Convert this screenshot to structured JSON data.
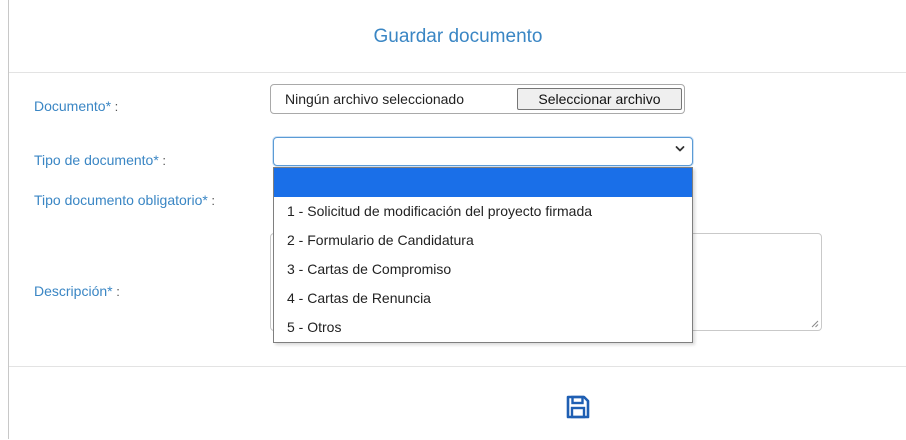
{
  "dialog": {
    "title": "Guardar documento"
  },
  "form": {
    "documento": {
      "label": "Documento*",
      "colon": " :",
      "file_status": "Ningún archivo seleccionado",
      "button_label": "Seleccionar archivo"
    },
    "tipo_documento": {
      "label": "Tipo de documento*",
      "colon": " :",
      "selected_value": ""
    },
    "tipo_documento_obligatorio": {
      "label": "Tipo documento obligatorio*",
      "colon": " :"
    },
    "descripcion": {
      "label": "Descripción*",
      "colon": " :",
      "value": ""
    }
  },
  "dropdown": {
    "options": [
      "",
      "1 - Solicitud de modificación del proyecto firmada",
      "2 - Formulario de Candidatura",
      "3 - Cartas de Compromiso",
      "4 - Cartas de Renuncia",
      "5 - Otros"
    ],
    "highlighted_index": 0
  },
  "icons": {
    "save": "floppy-disk-icon",
    "chevron": "chevron-down-icon"
  },
  "colors": {
    "accent": "#3a86c4",
    "highlight": "#1a6fe8"
  }
}
